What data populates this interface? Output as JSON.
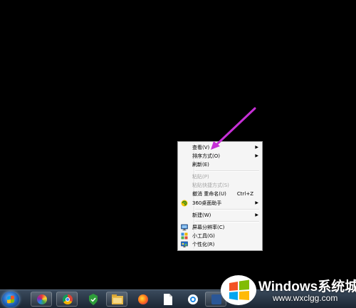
{
  "context_menu": {
    "items": [
      {
        "label": "查看(V)",
        "submenu": true,
        "enabled": true
      },
      {
        "label": "排序方式(O)",
        "submenu": true,
        "enabled": true
      },
      {
        "label": "刷新(E)",
        "submenu": false,
        "enabled": true
      },
      {
        "label": "粘贴(P)",
        "submenu": false,
        "enabled": false
      },
      {
        "label": "粘贴快捷方式(S)",
        "submenu": false,
        "enabled": false
      },
      {
        "label": "撤消 重命名(U)",
        "shortcut": "Ctrl+Z",
        "submenu": false,
        "enabled": true
      },
      {
        "label": "360桌面助手",
        "icon": "360-desktop-icon",
        "submenu": true,
        "enabled": true
      },
      {
        "label": "新建(W)",
        "submenu": true,
        "enabled": true
      },
      {
        "label": "屏幕分辨率(C)",
        "icon": "display-icon",
        "submenu": false,
        "enabled": true
      },
      {
        "label": "小工具(G)",
        "icon": "gadgets-icon",
        "submenu": false,
        "enabled": true
      },
      {
        "label": "个性化(R)",
        "icon": "personalize-icon",
        "submenu": false,
        "enabled": true
      }
    ]
  },
  "annotation": {
    "color": "#c62fd6",
    "icon": "arrow-annotation"
  },
  "taskbar": {
    "items": [
      {
        "icon": "start-orb-icon"
      },
      {
        "icon": "color-wheel-app-icon"
      },
      {
        "icon": "chrome-icon"
      },
      {
        "icon": "shield-security-icon"
      },
      {
        "icon": "file-explorer-icon"
      },
      {
        "icon": "firefox-icon"
      },
      {
        "icon": "document-icon"
      },
      {
        "icon": "browser-q-icon"
      },
      {
        "icon": "word-icon"
      }
    ]
  },
  "watermark": {
    "title": "Windows系统城",
    "url": "www.wxclgg.com"
  },
  "colors": {
    "desktop": "#000000",
    "menu_bg": "#f5f5f5",
    "disabled_text": "#a6a6a6",
    "arrow": "#c62fd6"
  }
}
